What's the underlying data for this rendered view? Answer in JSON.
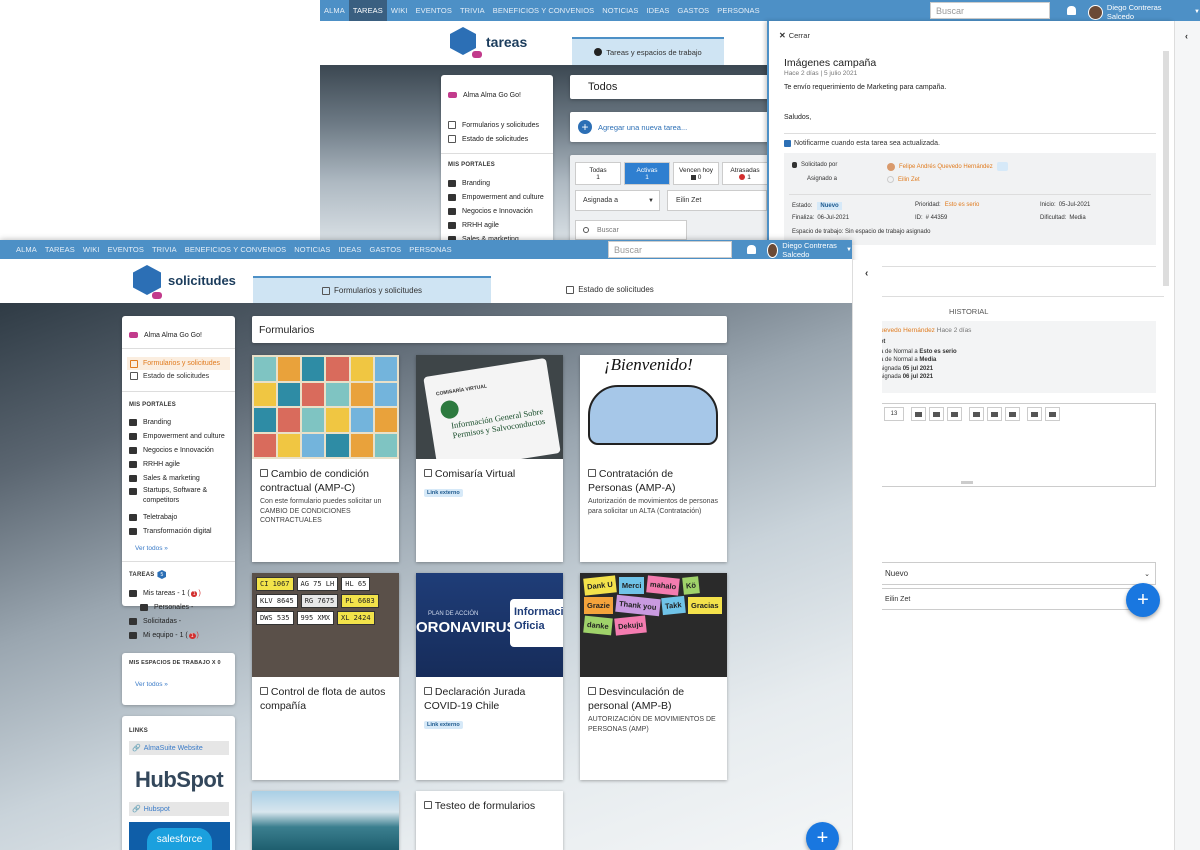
{
  "back_window": {
    "nav": [
      "ALMA",
      "TAREAS",
      "WIKI",
      "EVENTOS",
      "TRIVIA",
      "BENEFICIOS Y CONVENIOS",
      "NOTICIAS",
      "IDEAS",
      "GASTOS",
      "PERSONAS"
    ],
    "active_nav": "TAREAS",
    "search_placeholder": "Buscar",
    "user": "Diego Contreras Salcedo",
    "app_title": "tareas",
    "tab": "Tareas y espacios de trabajo",
    "sidebar": {
      "profile": "Alma Alma Go Go!",
      "links": [
        "Formularios y solicitudes",
        "Estado de solicitudes"
      ],
      "portals_heading": "MIS PORTALES",
      "portals": [
        "Branding",
        "Empowerment and culture",
        "Negocios e Innovación",
        "RRHH agile",
        "Sales & marketing"
      ]
    },
    "filter": "Todos",
    "add_task": "Agregar una nueva tarea...",
    "status_tabs": [
      {
        "label": "Todas",
        "count": "1"
      },
      {
        "label": "Activas",
        "count": "1"
      },
      {
        "label": "Vencen hoy",
        "count": "0"
      },
      {
        "label": "Atrasadas",
        "count": "1"
      }
    ],
    "assigned_select": "Asignada a",
    "assigned_value": "Eilin Zet",
    "search_tasks": "Buscar"
  },
  "detail": {
    "close": "Cerrar",
    "title": "Imágenes campaña",
    "meta": "Hace 2 días | 5 julio 2021",
    "body1": "Te envío requerimiento de Marketing para campaña.",
    "body2": "Saludos,",
    "notify": "Notificarme cuando esta tarea sea actualizada.",
    "requested_by_label": "Solicitado por",
    "requested_by": "Felipe Andrés Quevedo Hernández",
    "assigned_to_label": "Asignado a",
    "assigned_to": "Eilin Zet",
    "estado_label": "Estado:",
    "estado": "Nuevo",
    "prioridad_label": "Prioridad:",
    "prioridad": "Esto es serio",
    "inicio_label": "Inicio:",
    "inicio": "05-Jul-2021",
    "finaliza_label": "Finaliza:",
    "finaliza": "06-Jul-2021",
    "id_label": "ID:",
    "id": "# 44359",
    "dificultad_label": "Dificultad:",
    "dificultad": "Media",
    "workspace": "Espacio de trabajo: Sin espacio de trabajo asignado",
    "history_title": "HISTORIAL",
    "history_author": "uevedo Hernández",
    "history_time": "Hace 2 días",
    "history_lines": [
      {
        "prefix": "a de Normal a ",
        "value": "Esto es serio"
      },
      {
        "prefix": "a de Normal a ",
        "value": "Media"
      },
      {
        "prefix": "signada ",
        "value": "05 jul 2021"
      },
      {
        "prefix": "signada ",
        "value": "06 jul 2021"
      }
    ],
    "history_bold": "et",
    "font_size": "13",
    "status_select": "Nuevo",
    "assignee": "Eilin Zet"
  },
  "front_window": {
    "nav": [
      "ALMA",
      "TAREAS",
      "WIKI",
      "EVENTOS",
      "TRIVIA",
      "BENEFICIOS Y CONVENIOS",
      "NOTICIAS",
      "IDEAS",
      "GASTOS",
      "PERSONAS"
    ],
    "search_placeholder": "Buscar",
    "user": "Diego Contreras Salcedo",
    "app_title": "solicitudes",
    "tabs": [
      "Formularios y solicitudes",
      "Estado de solicitudes"
    ],
    "section_title": "Formularios",
    "sidebar": {
      "profile": "Alma Alma Go Go!",
      "links": [
        "Formularios y solicitudes",
        "Estado de solicitudes"
      ],
      "portals_heading": "MIS PORTALES",
      "portals": [
        "Branding",
        "Empowerment and culture",
        "Negocios e Innovación",
        "RRHH agile",
        "Sales & marketing",
        "Startups, Software & competitors",
        "Teletrabajo",
        "Transformación digital"
      ],
      "see_all": "Ver todos »",
      "tasks_heading": "TAREAS",
      "tasks_badge": "5",
      "tasks": [
        {
          "label": "Mis tareas - 1 (",
          "alert": "1",
          "end": ")"
        },
        {
          "label": "Personales -",
          "alert": "",
          "end": ""
        },
        {
          "label": "Solicitadas -",
          "alert": "",
          "end": ""
        },
        {
          "label": "Mi equipo - 1 (",
          "alert": "1",
          "end": ")"
        }
      ],
      "workspaces_heading": "MIS ESPACIOS DE TRABAJO X 0",
      "see_all2": "Ver todos »",
      "links_heading": "LINKS",
      "ext_links": [
        "AlmaSuite Website",
        "Hubspot"
      ],
      "hubspot_logo": "HubSpot",
      "salesforce_logo": "salesforce"
    },
    "cards": [
      {
        "title": "Cambio de condición contractual (AMP-C)",
        "desc": "Con este formulario puedes solicitar un CAMBIO DE CONDICIONES CONTRACTUALES",
        "badge": ""
      },
      {
        "title": "Comisaría Virtual",
        "desc": "",
        "badge": "Link externo"
      },
      {
        "title": "Contratación de Personas (AMP-A)",
        "desc": "Autorización de movimientos de personas para solicitar un ALTA (Contratación)",
        "badge": ""
      },
      {
        "title": "Control de flota de autos compañía",
        "desc": "",
        "badge": ""
      },
      {
        "title": "Declaración Jurada COVID-19 Chile",
        "desc": "",
        "badge": "Link externo"
      },
      {
        "title": "Desvinculación de personal (AMP-B)",
        "desc": "AUTORIZACIÓN DE MOVIMIENTOS DE PERSONAS (AMP)",
        "badge": ""
      },
      {
        "title": "",
        "desc": "",
        "badge": ""
      },
      {
        "title": "Testeo de formularios",
        "desc": "",
        "badge": ""
      }
    ],
    "card_images": {
      "comisaria": "Información General Sobre Permisos y Salvoconductos",
      "comisaria_header": "COMISARÍA VIRTUAL",
      "bienvenido": "¡Bienvenido!",
      "covid_text": "ORONAVIRUS",
      "covid_sub": "PLAN DE ACCIÓN",
      "covid_info": "Informació Oficia",
      "plates": [
        "CI 1067",
        "AG 75 LH",
        "HL 65",
        "KLV 8645",
        "RG 7675",
        "PL 6683",
        "DWS 535",
        "995 XMX",
        "XL 2424"
      ],
      "thanks": [
        "Dank U",
        "Merci",
        "mahalo",
        "Kö",
        "Grazie",
        "Thank you",
        "Takk",
        "Gracias",
        "danke",
        "Dekuju"
      ]
    }
  }
}
